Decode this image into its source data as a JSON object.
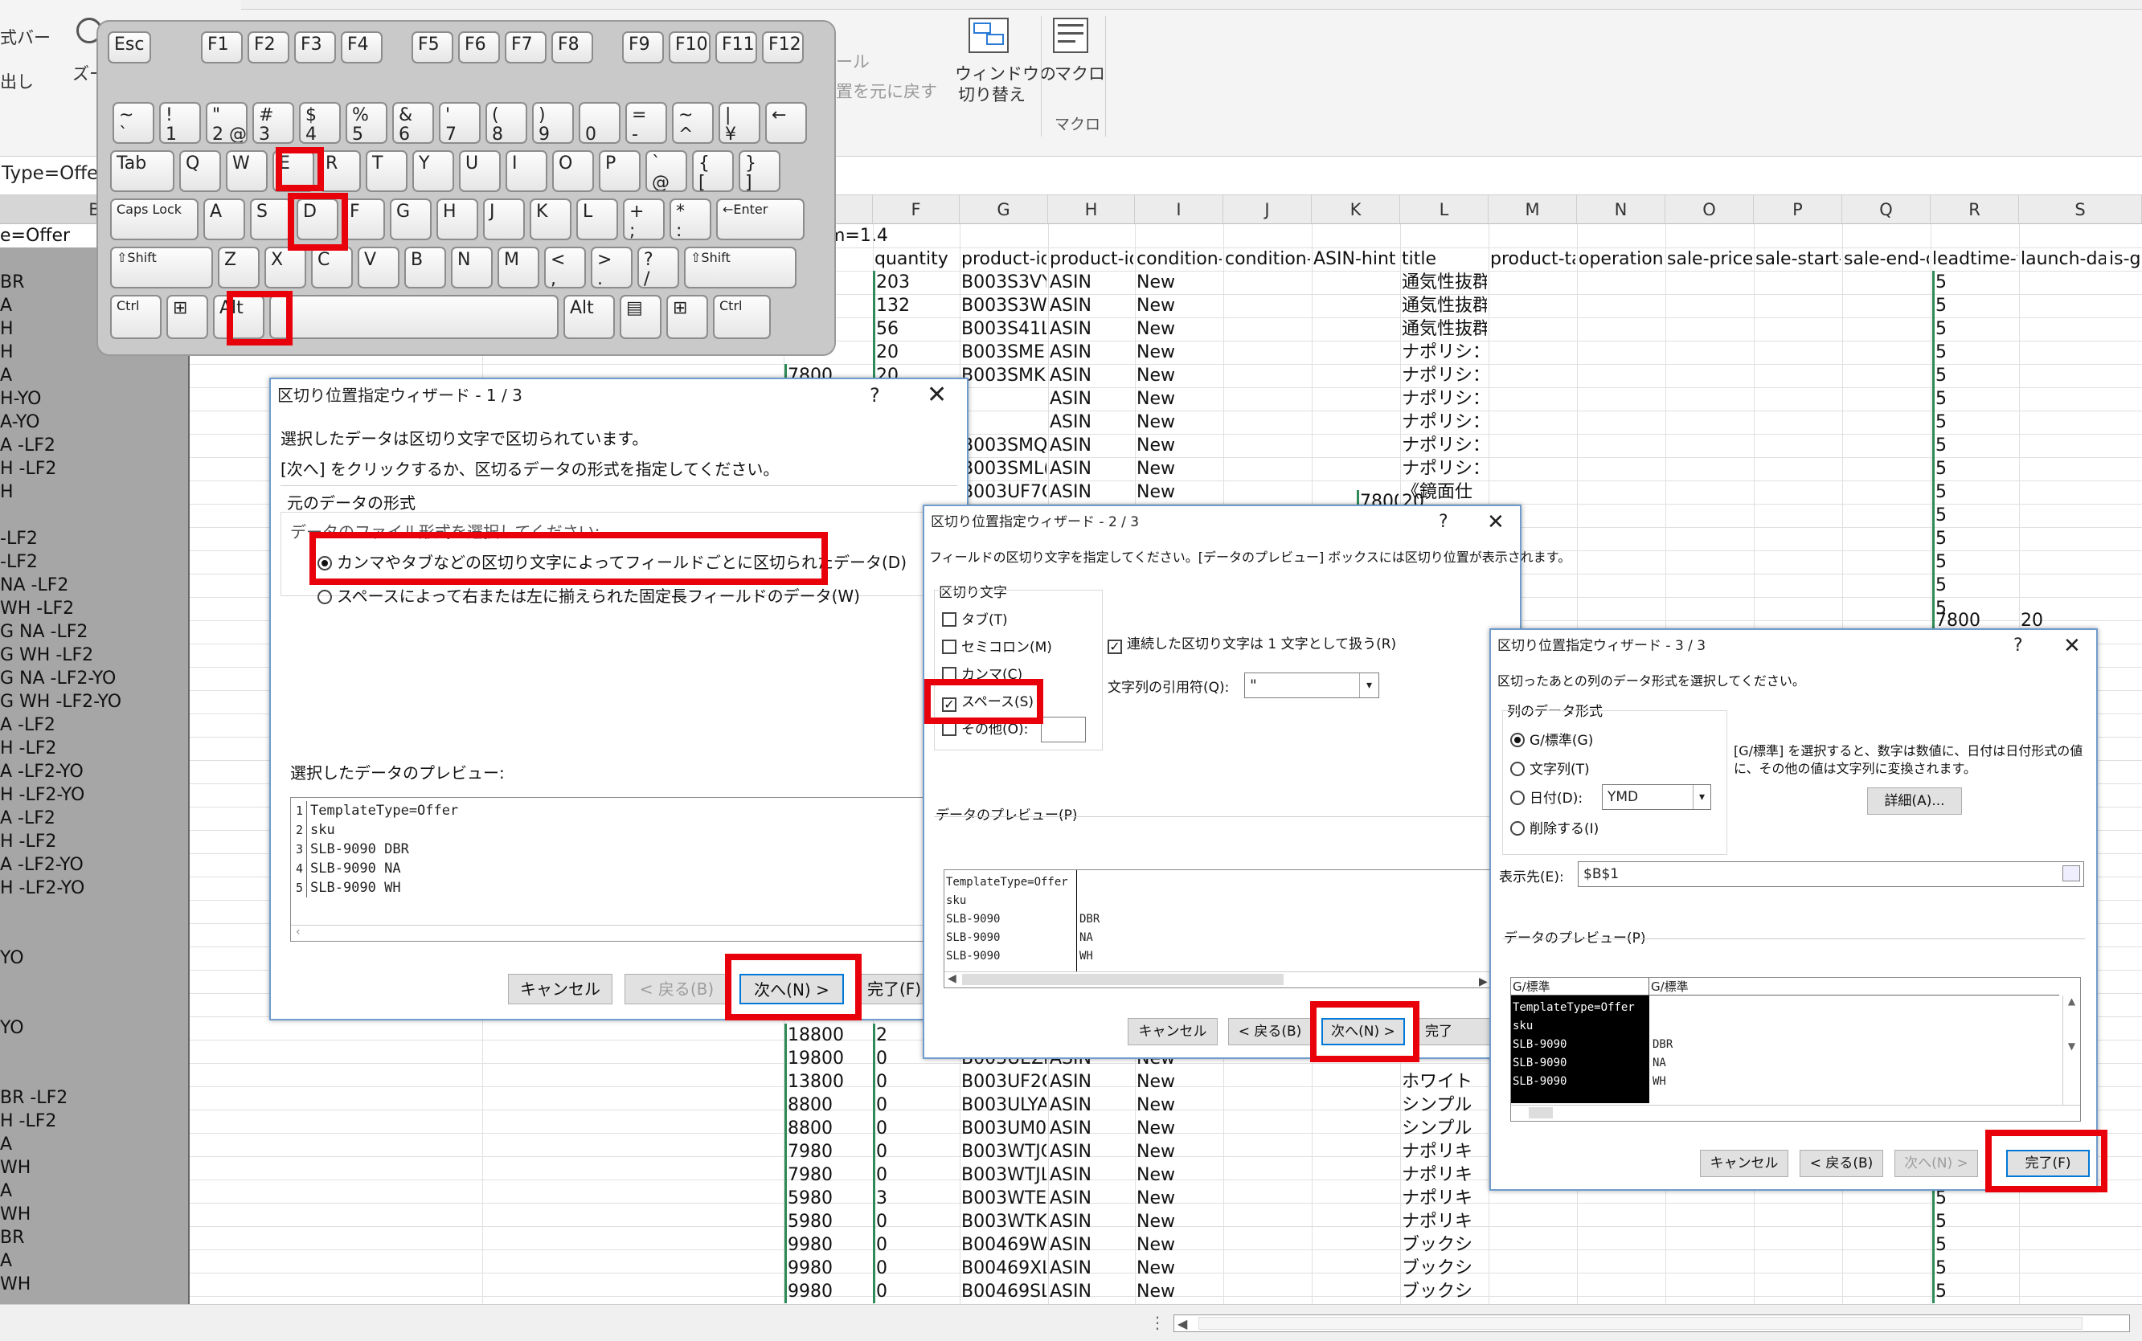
{
  "ribbon": {
    "left1": "式バー",
    "left2": "出し",
    "zoom_stub": "ズー",
    "faded1": "ール",
    "faded2": "置を元に戻す",
    "window_switch_line1": "ウィンドウの",
    "window_switch_line2": "切り替え",
    "macro_label": "マクロ",
    "macro_group": "マクロ"
  },
  "formula_bar": {
    "value": "Type=Offer"
  },
  "grid": {
    "columns": [
      {
        "letter": "B"
      },
      {
        "letter": "F"
      },
      {
        "letter": "G"
      },
      {
        "letter": "H"
      },
      {
        "letter": "I"
      },
      {
        "letter": "J"
      },
      {
        "letter": "K"
      },
      {
        "letter": "L"
      },
      {
        "letter": "M"
      },
      {
        "letter": "N"
      },
      {
        "letter": "O"
      },
      {
        "letter": "P"
      },
      {
        "letter": "Q"
      },
      {
        "letter": "R"
      },
      {
        "letter": "S"
      }
    ],
    "b_first": "e=Offer",
    "fragment_m14": "m=1.4",
    "headers": [
      "quantity",
      "product-id",
      "product-id-",
      "condition-t",
      "condition-n",
      "ASIN-hint",
      "title",
      "product-tax",
      "operation-t",
      "sale-price",
      "sale-start-d",
      "sale-end-d",
      "leadtime-to",
      "launch-dat",
      "is-g"
    ],
    "b_labels": [
      "BR",
      "A",
      "H",
      "H",
      "A",
      "H-YO",
      "A-YO",
      "A -LF2",
      "H -LF2",
      "H",
      "",
      "-LF2",
      "-LF2",
      "NA -LF2",
      "WH -LF2",
      "G NA -LF2",
      "G WH -LF2",
      "G NA -LF2-YO",
      "G WH -LF2-YO",
      "A -LF2",
      "H -LF2",
      "A -LF2-YO",
      "H -LF2-YO",
      "A -LF2",
      "H -LF2",
      "A -LF2-YO",
      "H -LF2-YO",
      "",
      "",
      "YO",
      "",
      "",
      "YO",
      "",
      "",
      "BR -LF2",
      "H -LF2",
      "A",
      "WH",
      "A",
      "WH",
      "BR",
      "A",
      "WH"
    ],
    "top_rows": [
      {
        "qty": "203",
        "pid": "B003S3VY",
        "type": "ASIN",
        "cond": "New",
        "title": "通気性抜群"
      },
      {
        "qty": "132",
        "pid": "B003S3WI",
        "type": "ASIN",
        "cond": "New",
        "title": "通気性抜群"
      },
      {
        "qty": "56",
        "pid": "B003S41L",
        "type": "ASIN",
        "cond": "New",
        "title": "通気性抜群"
      },
      {
        "qty": "20",
        "pid": "B003SMEI",
        "type": "ASIN",
        "cond": "New",
        "title": "ナポリシ："
      },
      {
        "price": "7800",
        "qty": "20",
        "pid": "B003SMKI",
        "type": "ASIN",
        "cond": "New",
        "title": "ナポリシ："
      },
      {
        "pid": "",
        "type": "ASIN",
        "cond": "New",
        "title": "ナポリシ："
      },
      {
        "pid": "",
        "type": "ASIN",
        "cond": "New",
        "title": "ナポリシ："
      },
      {
        "pid": "B003SMQ",
        "type": "ASIN",
        "cond": "New",
        "title": "ナポリシ："
      },
      {
        "pid": "B003SML(",
        "type": "ASIN",
        "cond": "New",
        "title": "ナポリシ："
      },
      {
        "pid": "B003UF7C",
        "type": "ASIN",
        "cond": "New",
        "title": "《鏡面仕"
      }
    ],
    "row9_extra": {
      "price": "7800",
      "qty": "20"
    },
    "row14_extra": {
      "price": "7800",
      "qty": "20"
    },
    "bottom_rows": [
      {
        "price": "18800",
        "qty": "2",
        "pid": "",
        "type": "",
        "cond": "",
        "title": ""
      },
      {
        "price": "19800",
        "qty": "0",
        "pid": "B003UEZF",
        "type": "ASIN",
        "cond": "New",
        "title": ""
      },
      {
        "price": "13800",
        "qty": "0",
        "pid": "B003UF2C",
        "type": "ASIN",
        "cond": "New",
        "title": "ホワイト"
      },
      {
        "price": "8800",
        "qty": "0",
        "pid": "B003ULYA",
        "type": "ASIN",
        "cond": "New",
        "title": "シンプル"
      },
      {
        "price": "8800",
        "qty": "0",
        "pid": "B003UM04",
        "type": "ASIN",
        "cond": "New",
        "title": "シンプル"
      },
      {
        "price": "7980",
        "qty": "0",
        "pid": "B003WTJC",
        "type": "ASIN",
        "cond": "New",
        "title": "ナポリキ"
      },
      {
        "price": "7980",
        "qty": "0",
        "pid": "B003WTJL",
        "type": "ASIN",
        "cond": "New",
        "title": "ナポリキ"
      },
      {
        "price": "5980",
        "qty": "3",
        "pid": "B003WTE1",
        "type": "ASIN",
        "cond": "New",
        "title": "ナポリキ"
      },
      {
        "price": "5980",
        "qty": "0",
        "pid": "B003WTK1",
        "type": "ASIN",
        "cond": "New",
        "title": "ナポリキ"
      },
      {
        "price": "9980",
        "qty": "0",
        "pid": "B00469W1",
        "type": "ASIN",
        "cond": "New",
        "title": "ブックシ"
      },
      {
        "price": "9980",
        "qty": "0",
        "pid": "B00469XL(",
        "type": "ASIN",
        "cond": "New",
        "title": "ブックシ"
      },
      {
        "price": "9980",
        "qty": "0",
        "pid": "B00469SL",
        "type": "ASIN",
        "cond": "New",
        "title": "ブックシ"
      }
    ],
    "leadtime_value": "5"
  },
  "keyboard": {
    "fn_row": [
      "Esc",
      "F1",
      "F2",
      "F3",
      "F4",
      "F5",
      "F6",
      "F7",
      "F8",
      "F9",
      "F10",
      "F11",
      "F12"
    ],
    "num_row": [
      "~\n`",
      "!\n1",
      "\"\n2 @",
      "#\n3",
      "$\n4",
      "%\n5",
      "&\n6",
      "'\n7",
      "(\n8",
      ")\n9",
      "\n0",
      "=\n-",
      "~\n^",
      "|\n¥",
      "←"
    ],
    "q_row": [
      "Tab",
      "Q",
      "W",
      "E",
      "R",
      "T",
      "Y",
      "U",
      "I",
      "O",
      "P",
      "`\n@",
      "{\n[",
      "}\n]"
    ],
    "a_row": [
      "Caps Lock",
      "A",
      "S",
      "D",
      "F",
      "G",
      "H",
      "J",
      "K",
      "L",
      "+\n;",
      "*\n:",
      "←Enter"
    ],
    "z_row": [
      "⇧Shift",
      "Z",
      "X",
      "C",
      "V",
      "B",
      "N",
      "M",
      "<\n,",
      ">\n.",
      "?\n/",
      "⇧Shift"
    ],
    "bottom_row": [
      "Ctrl",
      "⊞",
      "Alt",
      "",
      "Alt",
      "▤",
      "⊞",
      "Ctrl"
    ]
  },
  "wizard1": {
    "title": "区切り位置指定ウィザード - 1 / 3",
    "help": "?",
    "close": "✕",
    "line1": "選択したデータは区切り文字で区切られています。",
    "line2": "[次へ] をクリックするか、区切るデータの形式を指定してください。",
    "group_title": "元のデータの形式",
    "group_sub": "データのファイル形式を選択してください:",
    "opt_delimited": "カンマやタブなどの区切り文字によってフィールドごとに区切られたデータ(D)",
    "opt_fixed": "スペースによって右または左に揃えられた固定長フィールドのデータ(W)",
    "preview_label": "選択したデータのプレビュー:",
    "preview_nums": [
      "1",
      "2",
      "3",
      "4",
      "5"
    ],
    "preview_lines": [
      "TemplateType=Offer",
      "sku",
      "SLB-9090 DBR",
      "SLB-9090 NA",
      "SLB-9090 WH"
    ],
    "btn_cancel": "キャンセル",
    "btn_back": "< 戻る(B)",
    "btn_next": "次へ(N) >",
    "btn_finish": "完了(F)"
  },
  "wizard2": {
    "title": "区切り位置指定ウィザード - 2 / 3",
    "help": "?",
    "close": "✕",
    "desc": "フィールドの区切り文字を指定してください。[データのプレビュー] ボックスには区切り位置が表示されます。",
    "group": "区切り文字",
    "tab": "タブ(T)",
    "semicolon": "セミコロン(M)",
    "comma": "カンマ(C)",
    "space": "スペース(S)",
    "other": "その他(O):",
    "consecutive": "連続した区切り文字は 1 文字として扱う(R)",
    "qualifier_label": "文字列の引用符(Q):",
    "qualifier_value": "\"",
    "preview_label": "データのプレビュー(P)",
    "preview_col1": [
      "TemplateType=Offer",
      "sku",
      "SLB-9090",
      "SLB-9090",
      "SLB-9090"
    ],
    "preview_col2": [
      "",
      "",
      "DBR",
      "NA",
      "WH"
    ],
    "btn_cancel": "キャンセル",
    "btn_back": "< 戻る(B)",
    "btn_next": "次へ(N) >",
    "btn_finish": "完了"
  },
  "wizard3": {
    "title": "区切り位置指定ウィザード - 3 / 3",
    "help": "?",
    "close": "✕",
    "desc": "区切ったあとの列のデータ形式を選択してください。",
    "group": "列のデータ形式",
    "opt_general": "G/標準(G)",
    "opt_text": "文字列(T)",
    "opt_date": "日付(D):",
    "date_value": "YMD",
    "opt_skip": "削除する(I)",
    "info": "[G/標準] を選択すると、数字は数値に、日付は日付形式の値に、その他の値は文字列に変換されます。",
    "detail": "詳細(A)...",
    "dest_label": "表示先(E):",
    "dest_value": "$B$1",
    "preview_label": "データのプレビュー(P)",
    "preview_h1": "G/標準",
    "preview_h2": "G/標準",
    "preview_col1": [
      "TemplateType=Offer",
      "sku",
      "SLB-9090",
      "SLB-9090",
      "SLB-9090"
    ],
    "preview_col2": [
      "",
      "",
      "DBR",
      "NA",
      "WH"
    ],
    "btn_cancel": "キャンセル",
    "btn_back": "< 戻る(B)",
    "btn_next": "次へ(N) >",
    "btn_finish": "完了(F)"
  }
}
